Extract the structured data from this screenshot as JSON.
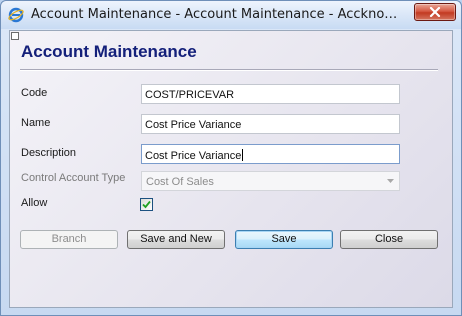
{
  "window": {
    "title": "Account Maintenance - Account Maintenance - Accknowledge System",
    "app_icon": "ie-app-icon",
    "close_icon": "close-icon"
  },
  "form": {
    "heading": "Account Maintenance",
    "fields": {
      "code": {
        "label": "Code",
        "value": "COST/PRICEVAR"
      },
      "name": {
        "label": "Name",
        "value": "Cost Price Variance"
      },
      "description": {
        "label": "Description",
        "value": "Cost Price Variance"
      },
      "control_account_type": {
        "label": "Control Account Type",
        "value": "Cost Of Sales",
        "enabled": false
      },
      "allow": {
        "label": "Allow",
        "checked": true
      }
    }
  },
  "buttons": {
    "branch": {
      "label": "Branch",
      "enabled": false
    },
    "save_and_new": {
      "label": "Save and New"
    },
    "save": {
      "label": "Save",
      "default": true
    },
    "close": {
      "label": "Close"
    }
  },
  "colors": {
    "heading": "#14207a",
    "title_bar": "#dce8f8",
    "close_button": "#c23a22",
    "default_button_border": "#3c7fb1"
  }
}
